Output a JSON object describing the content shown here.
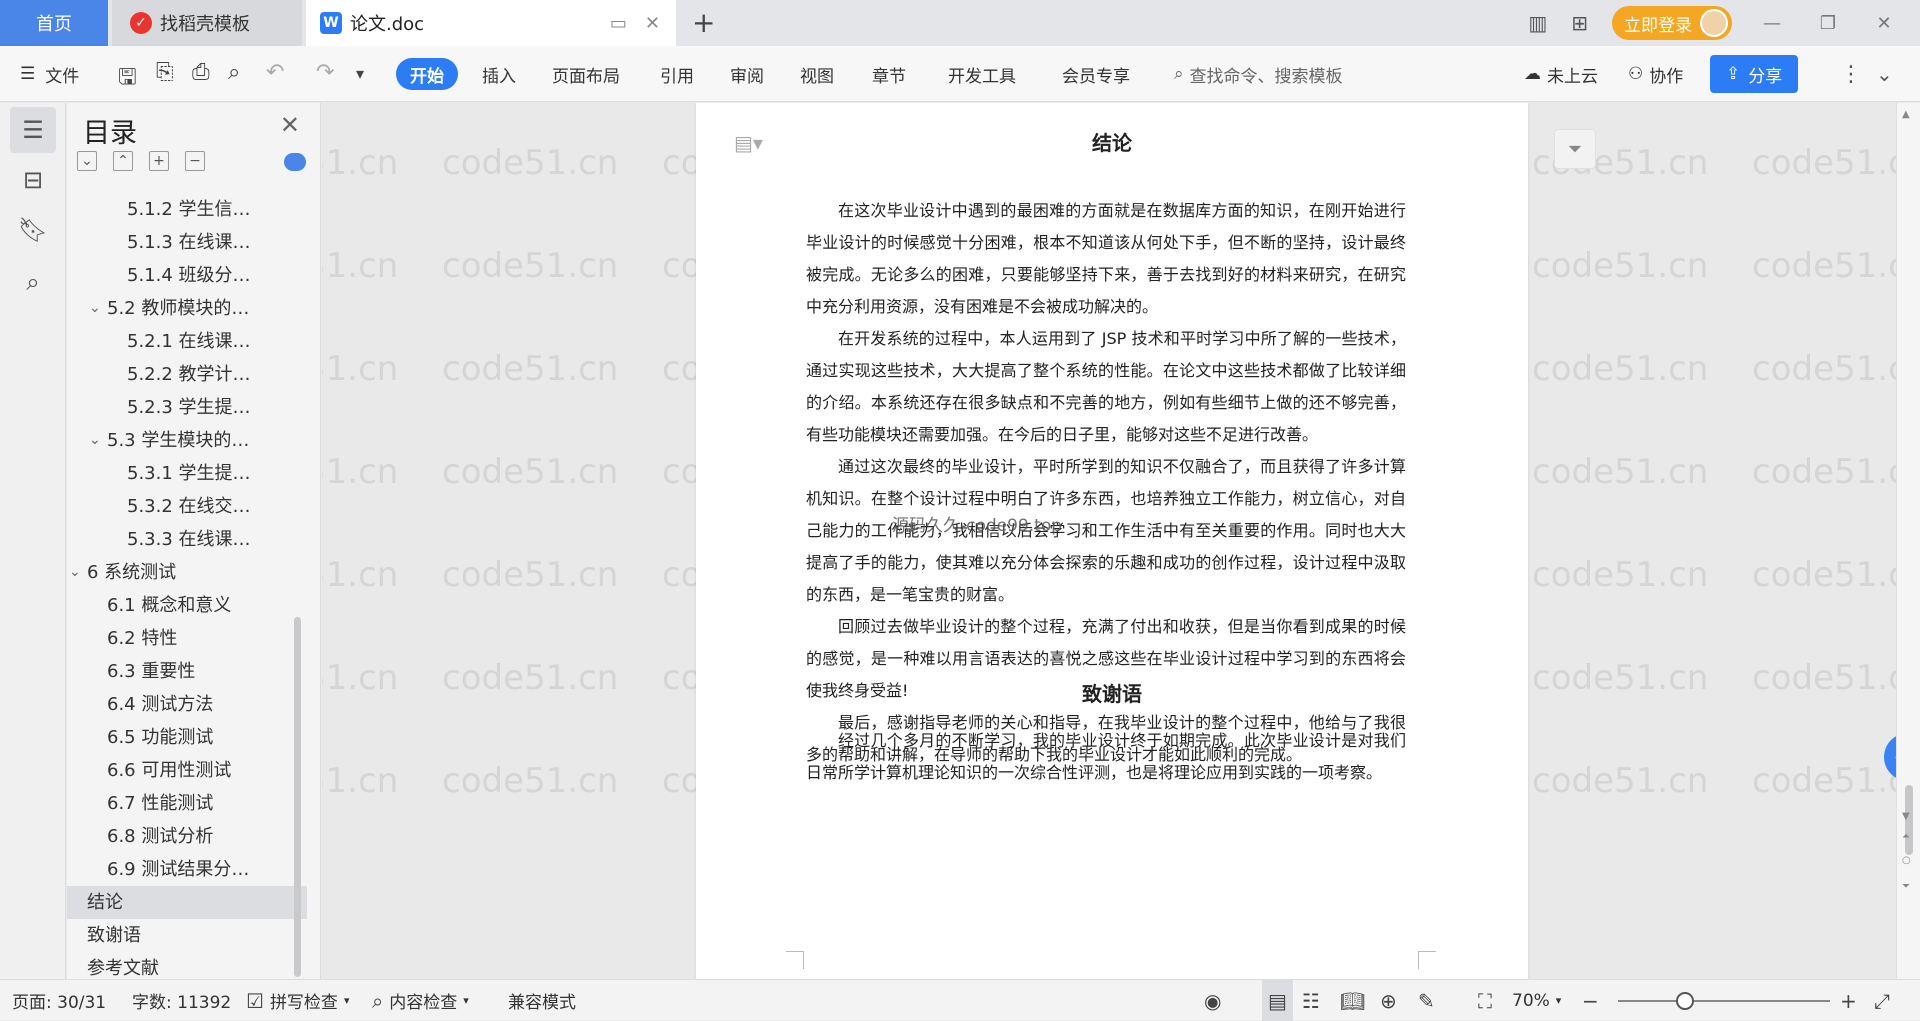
{
  "tabs": {
    "home": "首页",
    "template": "找稻壳模板",
    "doc": "论文.doc"
  },
  "titlebar": {
    "login_label": "立即登录"
  },
  "ribbon": {
    "file_label": "文件",
    "start": "开始",
    "insert": "插入",
    "layout": "页面布局",
    "reference": "引用",
    "review": "审阅",
    "view": "视图",
    "chapter": "章节",
    "devtools": "开发工具",
    "member": "会员专享",
    "search_placeholder": "查找命令、搜索模板",
    "cloud": "未上云",
    "collab": "协作",
    "share": "分享"
  },
  "toc": {
    "title": "目录",
    "items": [
      {
        "label": "5.1.2  学生信…",
        "level": 3
      },
      {
        "label": "5.1.3  在线课…",
        "level": 3
      },
      {
        "label": "5.1.4  班级分…",
        "level": 3
      },
      {
        "label": "5.2  教师模块的…",
        "level": 2,
        "expanded": true
      },
      {
        "label": "5.2.1  在线课…",
        "level": 3
      },
      {
        "label": "5.2.2  教学计…",
        "level": 3
      },
      {
        "label": "5.2.3  学生提…",
        "level": 3
      },
      {
        "label": "5.3  学生模块的…",
        "level": 2,
        "expanded": true
      },
      {
        "label": "5.3.1  学生提…",
        "level": 3
      },
      {
        "label": "5.3.2  在线交…",
        "level": 3
      },
      {
        "label": "5.3.3  在线课…",
        "level": 3
      },
      {
        "label": "6 系统测试",
        "level": 1,
        "expanded": true
      },
      {
        "label": "6.1 概念和意义",
        "level": 2
      },
      {
        "label": "6.2 特性",
        "level": 2
      },
      {
        "label": "6.3 重要性",
        "level": 2
      },
      {
        "label": "6.4 测试方法",
        "level": 2
      },
      {
        "label": "6.5  功能测试",
        "level": 2
      },
      {
        "label": "6.6 可用性测试",
        "level": 2
      },
      {
        "label": "6.7 性能测试",
        "level": 2
      },
      {
        "label": "6.8 测试分析",
        "level": 2
      },
      {
        "label": "6.9 测试结果分…",
        "level": 2
      },
      {
        "label": "结论",
        "level": 1,
        "active": true
      },
      {
        "label": "致谢语",
        "level": 1
      },
      {
        "label": "参考文献",
        "level": 1
      }
    ]
  },
  "document": {
    "conclusion_title": "结论",
    "paragraphs": [
      "在这次毕业设计中遇到的最困难的方面就是在数据库方面的知识，在刚开始进行毕业设计的时候感觉十分困难，根本不知道该从何处下手，但不断的坚持，设计最终被完成。无论多么的困难，只要能够坚持下来，善于去找到好的材料来研究，在研究中充分利用资源，没有困难是不会被成功解决的。",
      "在开发系统的过程中，本人运用到了 JSP 技术和平时学习中所了解的一些技术，通过实现这些技术，大大提高了整个系统的性能。在论文中这些技术都做了比较详细的介绍。本系统还存在很多缺点和不完善的地方，例如有些细节上做的还不够完善，有些功能模块还需要加强。在今后的日子里，能够对这些不足进行改善。",
      "通过这次最终的毕业设计，平时所学到的知识不仅融合了，而且获得了许多计算机知识。在整个设计过程中明白了许多东西，也培养独立工作能力，树立信心，对自己能力的工作能力，我相信以后会学习和工作生活中有至关重要的作用。同时也大大提高了手的能力，使其难以充分体会探索的乐趣和成功的创作过程，设计过程中汲取的东西，是一笔宝贵的财富。",
      "回顾过去做毕业设计的整个过程，充满了付出和收获，但是当你看到成果的时候的感觉，是一种难以用言语表达的喜悦之感这些在毕业设计过程中学习到的东西将会使我终身受益!",
      "最后，感谢指导老师的关心和指导，在我毕业设计的整个过程中，他给与了我很多的帮助和讲解，在导师的帮助下我的毕业设计才能如此顺利的完成。"
    ],
    "overlay_text": "源码久久-code99.top",
    "ack_title": "致谢语",
    "ack_paragraph": "经过几个多月的不断学习，我的毕业设计终于如期完成。此次毕业设计是对我们日常所学计算机理论知识的一次综合性评测，也是将理论应用到实践的一项考察。",
    "watermark": "code51.cn"
  },
  "statusbar": {
    "page": "页面: 30/31",
    "words": "字数: 11392",
    "spellcheck": "拼写检查",
    "content_check": "内容检查",
    "compat_mode": "兼容模式",
    "zoom": "70%"
  },
  "colors": {
    "accent": "#2b7cf5",
    "login": "#f5a623",
    "home_tab": "#4a86e8"
  }
}
